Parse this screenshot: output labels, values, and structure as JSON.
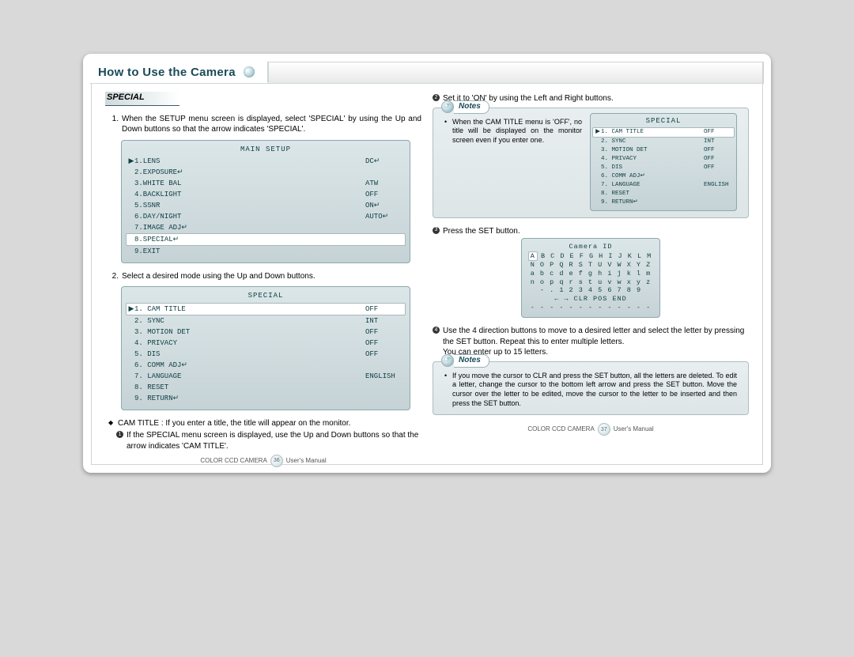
{
  "header": {
    "title": "How to Use the Camera"
  },
  "left": {
    "section": "SPECIAL",
    "step1": "When the SETUP menu screen is displayed, select 'SPECIAL' by using the Up and Down buttons so that the arrow indicates 'SPECIAL'.",
    "step2": "Select a desired mode using the Up and Down buttons.",
    "main_setup": {
      "title": "MAIN SETUP",
      "rows": [
        {
          "label": "1.LENS",
          "val": "DC↵",
          "sel": true
        },
        {
          "label": "2.EXPOSURE↵",
          "val": ""
        },
        {
          "label": "3.WHITE BAL",
          "val": "ATW"
        },
        {
          "label": "4.BACKLIGHT",
          "val": "OFF"
        },
        {
          "label": "5.SSNR",
          "val": "ON↵"
        },
        {
          "label": "6.DAY/NIGHT",
          "val": "AUTO↵"
        },
        {
          "label": "7.IMAGE ADJ↵",
          "val": ""
        },
        {
          "label": "8.SPECIAL↵",
          "val": "",
          "hi": true
        },
        {
          "label": "9.EXIT",
          "val": ""
        }
      ]
    },
    "special_menu": {
      "title": "SPECIAL",
      "rows": [
        {
          "label": "1. CAM TITLE",
          "val": "OFF",
          "sel": true,
          "hi": true
        },
        {
          "label": "2. SYNC",
          "val": "INT"
        },
        {
          "label": "3. MOTION DET",
          "val": "OFF"
        },
        {
          "label": "4. PRIVACY",
          "val": "OFF"
        },
        {
          "label": "5. DIS",
          "val": "OFF"
        },
        {
          "label": "6. COMM ADJ↵",
          "val": ""
        },
        {
          "label": "7. LANGUAGE",
          "val": "ENGLISH"
        },
        {
          "label": "8. RESET",
          "val": ""
        },
        {
          "label": "9. RETURN↵",
          "val": ""
        }
      ]
    },
    "diamond": "CAM TITLE : If you enter a title, the title will appear on the monitor.",
    "sub1": "If the SPECIAL menu screen is displayed, use the Up and Down buttons so that the arrow indicates 'CAM TITLE'."
  },
  "right": {
    "step2b": "Set it to 'ON' by using the Left and Right buttons.",
    "notes_label": "Notes",
    "note1_text": "When the CAM TITLE menu is 'OFF', no title will be displayed on the monitor screen even if you enter one.",
    "note1_osd": {
      "title": "SPECIAL",
      "rows": [
        {
          "label": "1. CAM TITLE",
          "val": "OFF",
          "sel": true,
          "hi": true
        },
        {
          "label": "2. SYNC",
          "val": "INT"
        },
        {
          "label": "3. MOTION DET",
          "val": "OFF"
        },
        {
          "label": "4. PRIVACY",
          "val": "OFF"
        },
        {
          "label": "5. DIS",
          "val": "OFF"
        },
        {
          "label": "6. COMM ADJ↵",
          "val": ""
        },
        {
          "label": "7. LANGUAGE",
          "val": "ENGLISH"
        },
        {
          "label": "8. RESET",
          "val": ""
        },
        {
          "label": "9. RETURN↵",
          "val": ""
        }
      ]
    },
    "step3": "Press the SET button.",
    "camera_id": {
      "title": "Camera ID",
      "r1": "A B C D E F G H I J K L M",
      "r1_hi": "A",
      "r1_rest": "B C D E F G H I J K L M",
      "r2": "N O P Q R S T U V W X Y Z",
      "r3": "a b c d e f g h i j k l m",
      "r4": "n o p q r s t u v w x y z",
      "r5": "- . 1 2 3 4 5 6 7 8 9",
      "r6": "← →   CLR  POS  END",
      "r7": "- - - - - - - - - - - - -"
    },
    "step4": "Use the 4 direction buttons to move to a desired letter and select the letter by pressing the SET button. Repeat this to enter multiple letters.",
    "step4b": "You can enter up to 15 letters.",
    "note2_text": "If you move the cursor to CLR and press the SET button, all the letters are deleted. To edit a letter, change the cursor to the bottom left arrow and press the SET button. Move the cursor over the letter to be edited, move the cursor to the letter to be inserted and then press the SET button."
  },
  "footer": {
    "product": "COLOR CCD CAMERA",
    "page_left": "36",
    "page_right": "37",
    "suffix": "User's Manual"
  }
}
